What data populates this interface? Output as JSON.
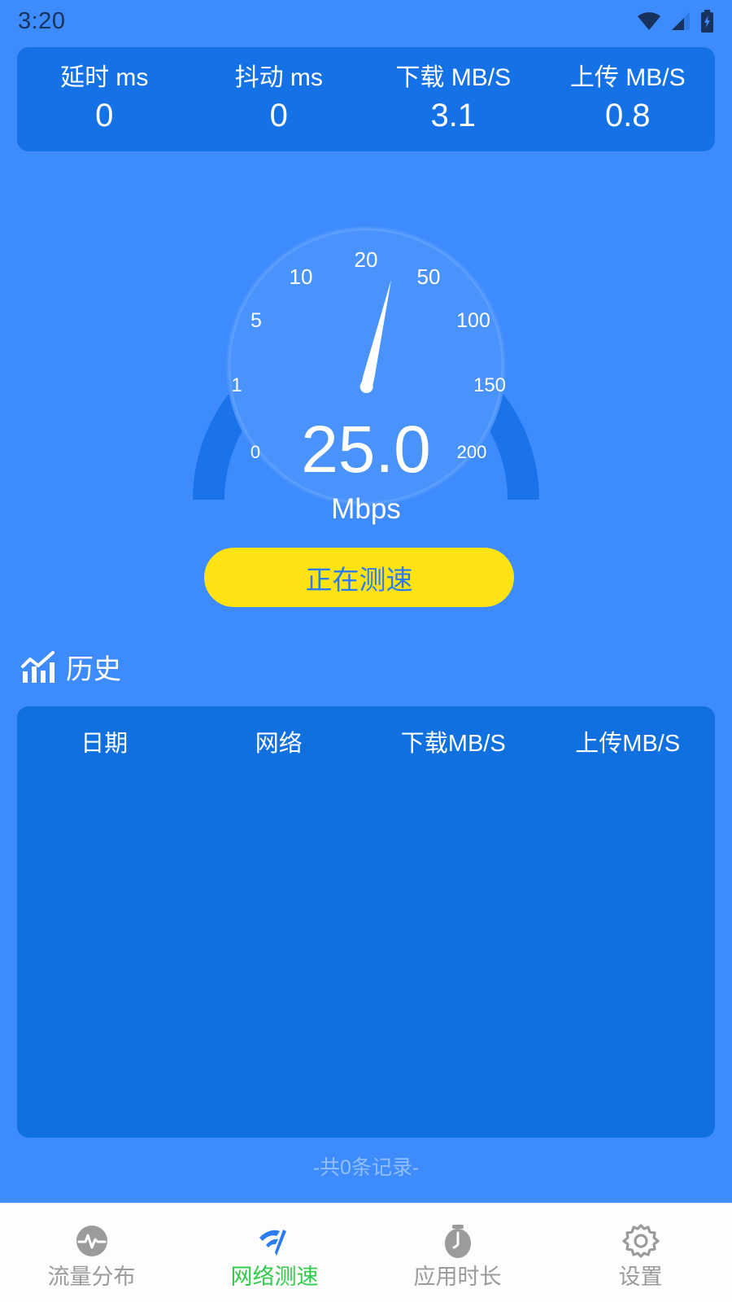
{
  "statusbar": {
    "time": "3:20",
    "icons": [
      "wifi-icon",
      "cellular-signal-icon",
      "battery-charging-icon"
    ]
  },
  "metrics": [
    {
      "label": "延时 ms",
      "value": "0",
      "name": "latency"
    },
    {
      "label": "抖动 ms",
      "value": "0",
      "name": "jitter"
    },
    {
      "label": "下载 MB/S",
      "value": "3.1",
      "name": "download"
    },
    {
      "label": "上传 MB/S",
      "value": "0.8",
      "name": "upload"
    }
  ],
  "gauge": {
    "value": "25.0",
    "unit": "Mbps",
    "ticks": [
      "0",
      "1",
      "5",
      "10",
      "20",
      "50",
      "100",
      "150",
      "200"
    ],
    "needle_value": 25,
    "arc_color": "#1a73e8",
    "dial_color": "#4a93fd"
  },
  "action_button": {
    "label": "正在测速"
  },
  "history": {
    "icon": "bar-chart-icon",
    "title": "历史",
    "columns": [
      "日期",
      "网络",
      "下载MB/S",
      "上传MB/S"
    ],
    "rows": [],
    "record_count_text": "-共0条记录-"
  },
  "bottom_nav": [
    {
      "label": "流量分布",
      "icon": "pulse-circle-icon",
      "active": false
    },
    {
      "label": "网络测速",
      "icon": "wifi-speed-icon",
      "active": true
    },
    {
      "label": "应用时长",
      "icon": "stopwatch-icon",
      "active": false
    },
    {
      "label": "设置",
      "icon": "gear-icon",
      "active": false
    }
  ],
  "colors": {
    "background": "#3d8bfd",
    "card": "#1472e6",
    "table": "#1070e0",
    "accent_yellow": "#ffe312",
    "accent_green": "#2fcc4a",
    "button_text": "#2a7cf0"
  },
  "chart_data": {
    "type": "table",
    "title": "历史",
    "columns": [
      "日期",
      "网络",
      "下载MB/S",
      "上传MB/S"
    ],
    "rows": []
  }
}
